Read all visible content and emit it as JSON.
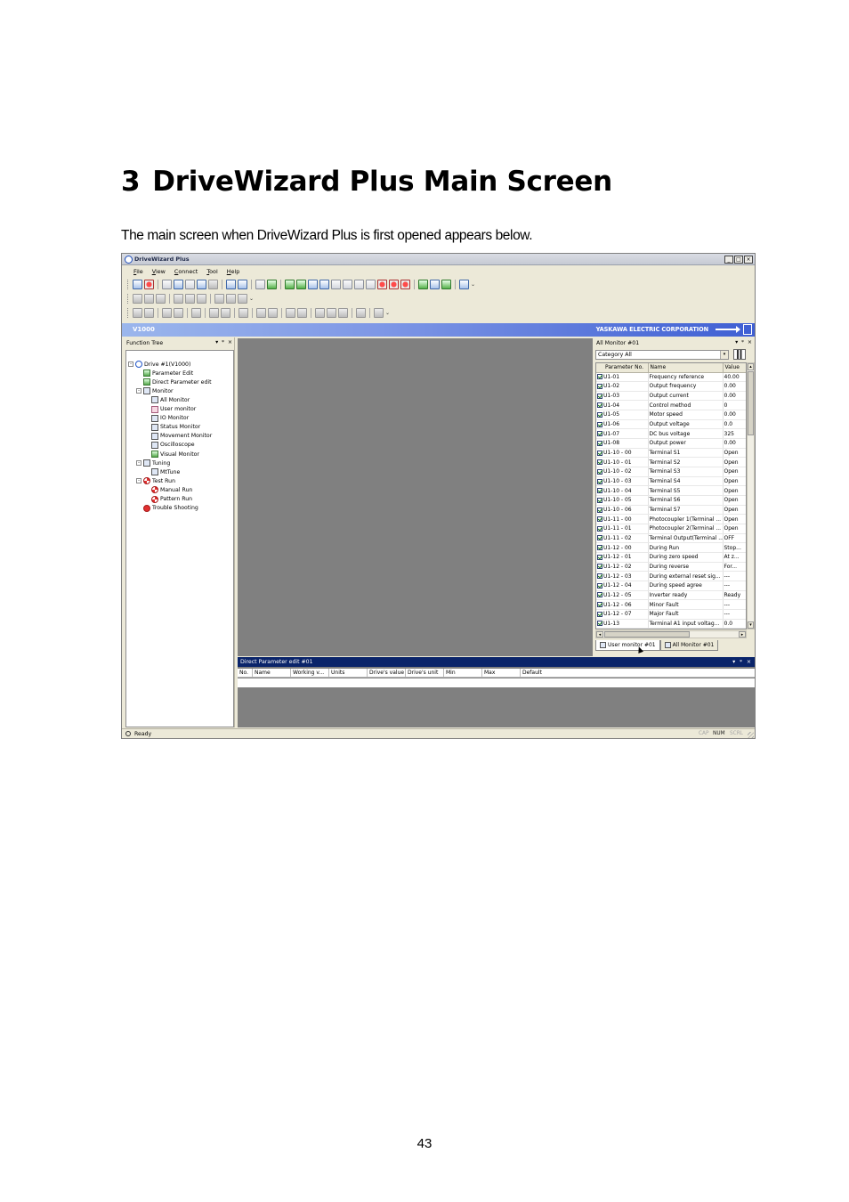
{
  "heading": {
    "number": "3",
    "title": "DriveWizard Plus Main Screen"
  },
  "intro": "The main screen when DriveWizard Plus is first opened appears below.",
  "page_number": "43",
  "app": {
    "title": "DriveWizard Plus",
    "window_buttons": [
      "_",
      "□",
      "×"
    ],
    "menu": [
      "File",
      "View",
      "Connect",
      "Tool",
      "Help"
    ],
    "brand_bar": {
      "model": "V1000",
      "company": "YASKAWA ELECTRIC CORPORATION"
    },
    "function_tree": {
      "title": "Function Tree",
      "panel_buttons": [
        "▾",
        "ᵠ",
        "×"
      ],
      "items": [
        {
          "label": "Drive #1(V1000)",
          "icon": "drive-icon",
          "level": 0,
          "expander": "-"
        },
        {
          "label": "Parameter Edit",
          "icon": "parameter-edit-icon",
          "level": 1
        },
        {
          "label": "Direct Parameter edit",
          "icon": "direct-parameter-edit-icon",
          "level": 1
        },
        {
          "label": "Monitor",
          "icon": "monitor-icon",
          "level": 1,
          "expander": "-"
        },
        {
          "label": "All Monitor",
          "icon": "all-monitor-icon",
          "level": 2
        },
        {
          "label": "User monitor",
          "icon": "user-monitor-icon",
          "level": 2
        },
        {
          "label": "IO Monitor",
          "icon": "io-monitor-icon",
          "level": 2
        },
        {
          "label": "Status Monitor",
          "icon": "status-monitor-icon",
          "level": 2
        },
        {
          "label": "Movement Monitor",
          "icon": "movement-monitor-icon",
          "level": 2
        },
        {
          "label": "Oscilloscope",
          "icon": "oscilloscope-icon",
          "level": 2
        },
        {
          "label": "Visual Monitor",
          "icon": "visual-monitor-icon",
          "level": 2
        },
        {
          "label": "Tuning",
          "icon": "tuning-icon",
          "level": 1,
          "expander": "-"
        },
        {
          "label": "MtTune",
          "icon": "mttune-icon",
          "level": 2
        },
        {
          "label": "Test Run",
          "icon": "test-run-icon",
          "level": 1,
          "expander": "-"
        },
        {
          "label": "Manual Run",
          "icon": "manual-run-icon",
          "level": 2
        },
        {
          "label": "Pattern Run",
          "icon": "pattern-run-icon",
          "level": 2
        },
        {
          "label": "Trouble Shooting",
          "icon": "trouble-shooting-icon",
          "level": 1
        }
      ]
    },
    "all_monitor": {
      "title": "All Monitor #01",
      "panel_buttons": [
        "▾",
        "ᵠ",
        "×"
      ],
      "category_label": "Category",
      "category_value": "All",
      "columns": [
        "Parameter No.",
        "Name",
        "Value"
      ],
      "rows": [
        [
          "U1-01",
          "Frequency reference",
          "40.00"
        ],
        [
          "U1-02",
          "Output frequency",
          "0.00"
        ],
        [
          "U1-03",
          "Output current",
          "0.00"
        ],
        [
          "U1-04",
          "Control method",
          "0"
        ],
        [
          "U1-05",
          "Motor speed",
          "0.00"
        ],
        [
          "U1-06",
          "Output voltage",
          "0.0"
        ],
        [
          "U1-07",
          "DC bus voltage",
          "325"
        ],
        [
          "U1-08",
          "Output power",
          "0.00"
        ],
        [
          "U1-10 - 00",
          "Terminal S1",
          "Open"
        ],
        [
          "U1-10 - 01",
          "Terminal S2",
          "Open"
        ],
        [
          "U1-10 - 02",
          "Terminal S3",
          "Open"
        ],
        [
          "U1-10 - 03",
          "Terminal S4",
          "Open"
        ],
        [
          "U1-10 - 04",
          "Terminal S5",
          "Open"
        ],
        [
          "U1-10 - 05",
          "Terminal S6",
          "Open"
        ],
        [
          "U1-10 - 06",
          "Terminal S7",
          "Open"
        ],
        [
          "U1-11 - 00",
          "Photocoupler 1(Terminal ...",
          "Open"
        ],
        [
          "U1-11 - 01",
          "Photocoupler 2(Terminal ...",
          "Open"
        ],
        [
          "U1-11 - 02",
          "Terminal Output(Terminal ...",
          "OFF"
        ],
        [
          "U1-12 - 00",
          "During Run",
          "Stop..."
        ],
        [
          "U1-12 - 01",
          "During zero speed",
          "At z..."
        ],
        [
          "U1-12 - 02",
          "During reverse",
          "For..."
        ],
        [
          "U1-12 - 03",
          "During external reset sig...",
          "---"
        ],
        [
          "U1-12 - 04",
          "During speed agree",
          "---"
        ],
        [
          "U1-12 - 05",
          "Inverter ready",
          "Ready"
        ],
        [
          "U1-12 - 06",
          "Minor Fault",
          "---"
        ],
        [
          "U1-12 - 07",
          "Major Fault",
          "---"
        ],
        [
          "U1-13",
          "Terminal A1 input voltag...",
          "0.0"
        ]
      ],
      "tabs": [
        "User monitor #01",
        "All Monitor #01"
      ]
    },
    "direct_parameter_edit": {
      "title": "Direct Parameter edit #01",
      "panel_buttons": [
        "▾",
        "ᵠ",
        "×"
      ],
      "columns": [
        "No.",
        "Name",
        "Working v...",
        "Units",
        "Drive's value",
        "Drive's unit",
        "Min",
        "Max",
        "Default"
      ]
    },
    "status_bar": {
      "text": "Ready",
      "indicators": [
        "CAP",
        "NUM",
        "SCRL"
      ],
      "active_indicator": "NUM"
    }
  }
}
